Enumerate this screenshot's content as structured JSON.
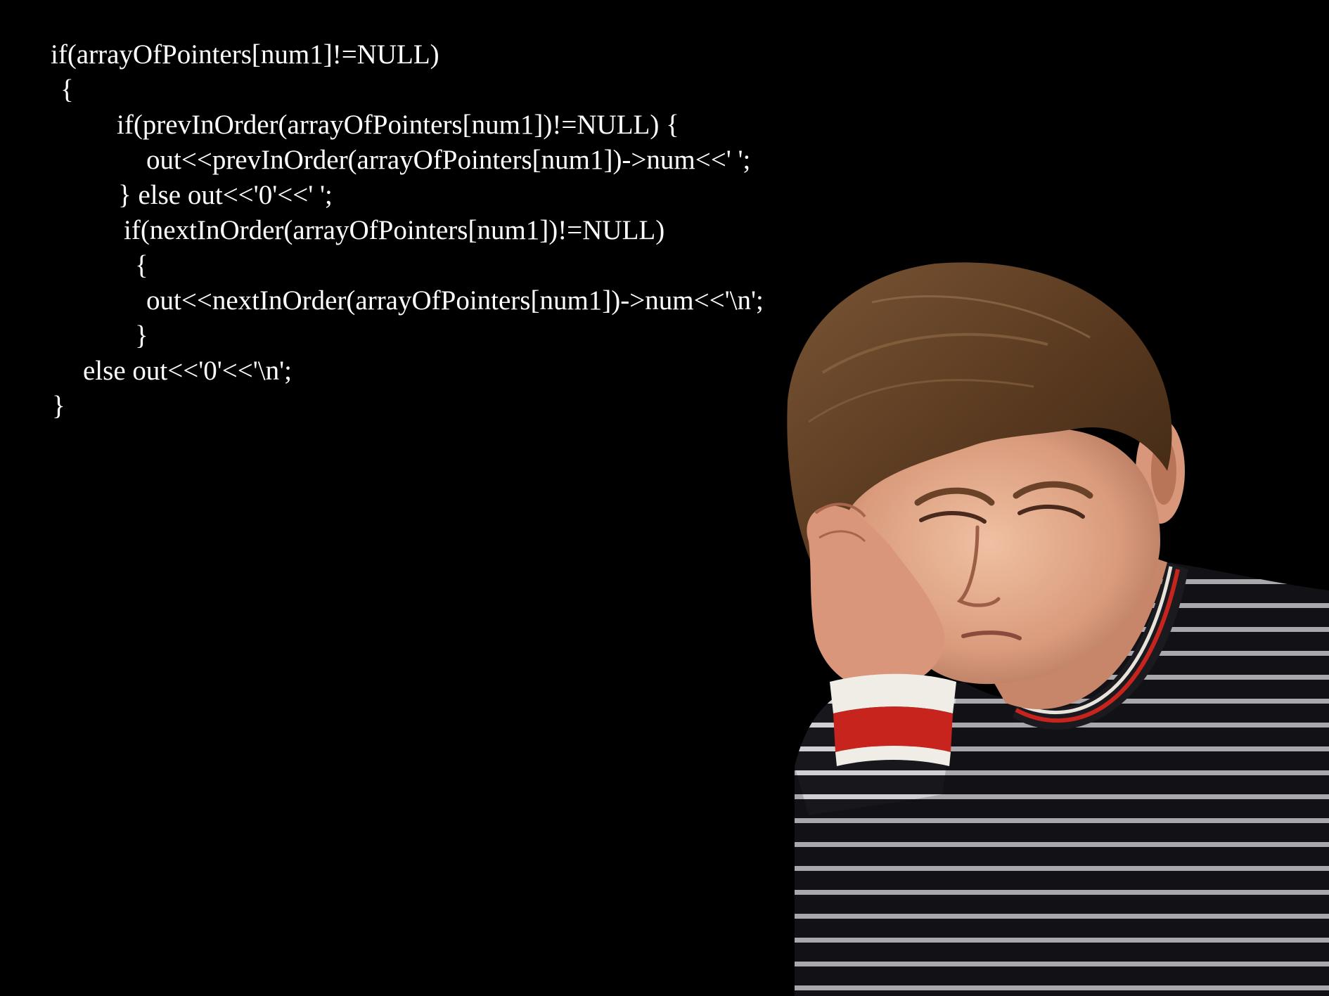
{
  "code": {
    "lines": [
      "if(arrayOfPointers[num1]!=NULL)",
      "{",
      "if(prevInOrder(arrayOfPointers[num1])!=NULL) {",
      "out<<prevInOrder(arrayOfPointers[num1])->num<<' ';",
      "} else out<<'0'<<' ';",
      "if(nextInOrder(arrayOfPointers[num1])!=NULL)",
      "{",
      "out<<nextInOrder(arrayOfPointers[num1])->num<<'\\n';",
      "}",
      "else out<<'0'<<'\\n';",
      "}"
    ]
  },
  "colors": {
    "background": "#000000",
    "code_text": "#ffffff",
    "hair": "#5a3a20",
    "skin": "#e2a98a",
    "sweater_dark": "#1a1a1f",
    "sweater_stripe": "#d8d8dc",
    "cuff_red": "#c8241e"
  },
  "photo": {
    "subject": "person-resting-head-on-hand",
    "clothing": "striped-sweater"
  }
}
